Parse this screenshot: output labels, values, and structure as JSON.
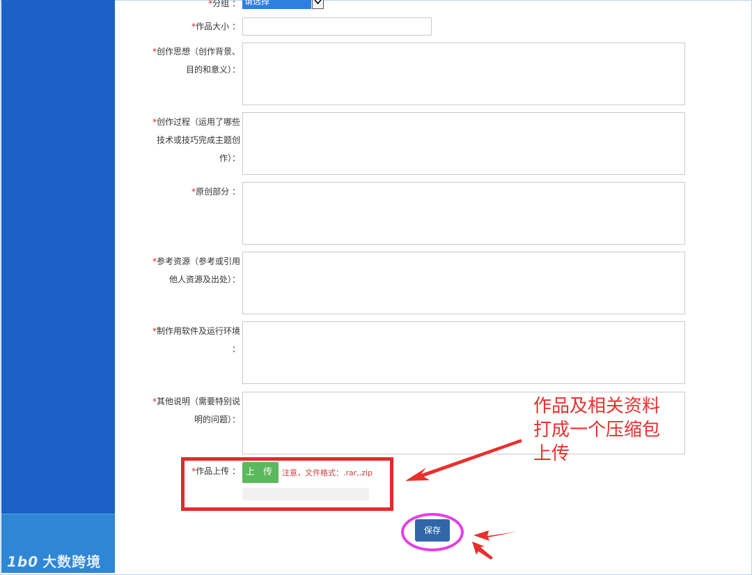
{
  "watermark": {
    "logo": "1b0",
    "text": "大数跨境"
  },
  "fields": {
    "group": {
      "label": "分组 ：",
      "select_value": "请选择"
    },
    "size": {
      "label": "作品大小 ："
    },
    "idea": {
      "line1": "创作思想（创作背景、",
      "line2": "目的和意义）："
    },
    "process": {
      "line1": "创作过程（运用了哪些",
      "line2": "技术或技巧完成主题创",
      "line3": "作）："
    },
    "original": {
      "label": "原创部分 ："
    },
    "reference": {
      "line1": "参考资源（参考或引用",
      "line2": "他人资源及出处）："
    },
    "software": {
      "line1": "制作用软件及运行环境",
      "line2": "："
    },
    "other": {
      "line1": "其他说明（需要特别说",
      "line2": "明的问题）："
    },
    "upload": {
      "label": "作品上传 ：",
      "button": "上 传",
      "note": "注意，文件格式：.rar,.zip"
    }
  },
  "required_mark": "*",
  "save_button": "保存",
  "annotation": {
    "line1": "作品及相关资料",
    "line2": "打成一个压缩包",
    "line3": "上传"
  },
  "colors": {
    "sidebar": "#1b61c8",
    "required": "#e02020",
    "upload": "#5cb85c",
    "save": "#2f67a8",
    "highlight_red": "#e42a2a",
    "highlight_magenta": "#e63ce6"
  }
}
